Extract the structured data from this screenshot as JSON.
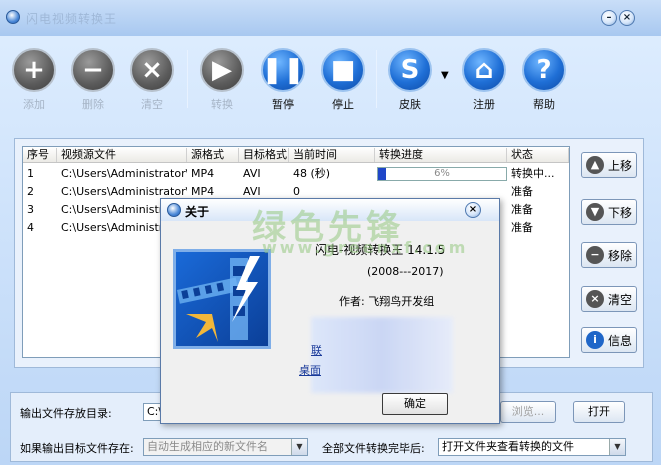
{
  "window": {
    "title": "闪电视频转换王"
  },
  "toolbar": {
    "add": "添加",
    "remove": "删除",
    "clear": "清空",
    "convert": "转换",
    "pause": "暂停",
    "stop": "停止",
    "skin": "皮肤",
    "register": "注册",
    "help": "帮助"
  },
  "table": {
    "headers": [
      "序号",
      "视频源文件",
      "源格式",
      "目标格式",
      "当前时间",
      "转换进度",
      "状态"
    ],
    "rows": [
      {
        "no": "1",
        "file": "C:\\Users\\Administrator\\Desk...",
        "src": "MP4",
        "dst": "AVI",
        "time": "48  (秒)",
        "progress_text": "6%",
        "progress": 0.06,
        "status": "转换中..."
      },
      {
        "no": "2",
        "file": "C:\\Users\\Administrator\\Desk",
        "src": "MP4",
        "dst": "AVI",
        "time": "0",
        "progress_text": "",
        "progress": 0,
        "status": "准备"
      },
      {
        "no": "3",
        "file": "C:\\Users\\Administrator\\D",
        "src": "",
        "dst": "",
        "time": "",
        "progress_text": "",
        "progress": 0,
        "status": "准备"
      },
      {
        "no": "4",
        "file": "C:\\Users\\Administrator\\D",
        "src": "",
        "dst": "",
        "time": "",
        "progress_text": "",
        "progress": 0,
        "status": "准备"
      }
    ]
  },
  "side": {
    "up": "上移",
    "down": "下移",
    "remove": "移除",
    "clear": "清空",
    "info": "信息"
  },
  "bottom": {
    "output_dir_label": "输出文件存放目录:",
    "output_dir_value": "C:\\",
    "browse": "浏览...",
    "open": "打开",
    "exists_label": "如果输出目标文件存在:",
    "exists_value": "自动生成相应的新文件名",
    "after_label": "全部文件转换完毕后:",
    "after_value": "打开文件夹查看转换的文件"
  },
  "dialog": {
    "title": "关于",
    "product": "闪电-视频转换王 14.1.5",
    "years": "(2008---2017)",
    "author": "作者: 飞翔鸟开发组",
    "link1": "联",
    "link2": "桌面",
    "ok": "确定"
  },
  "watermark": {
    "line1": "绿色先锋",
    "line2": "www.greenxf.com"
  }
}
